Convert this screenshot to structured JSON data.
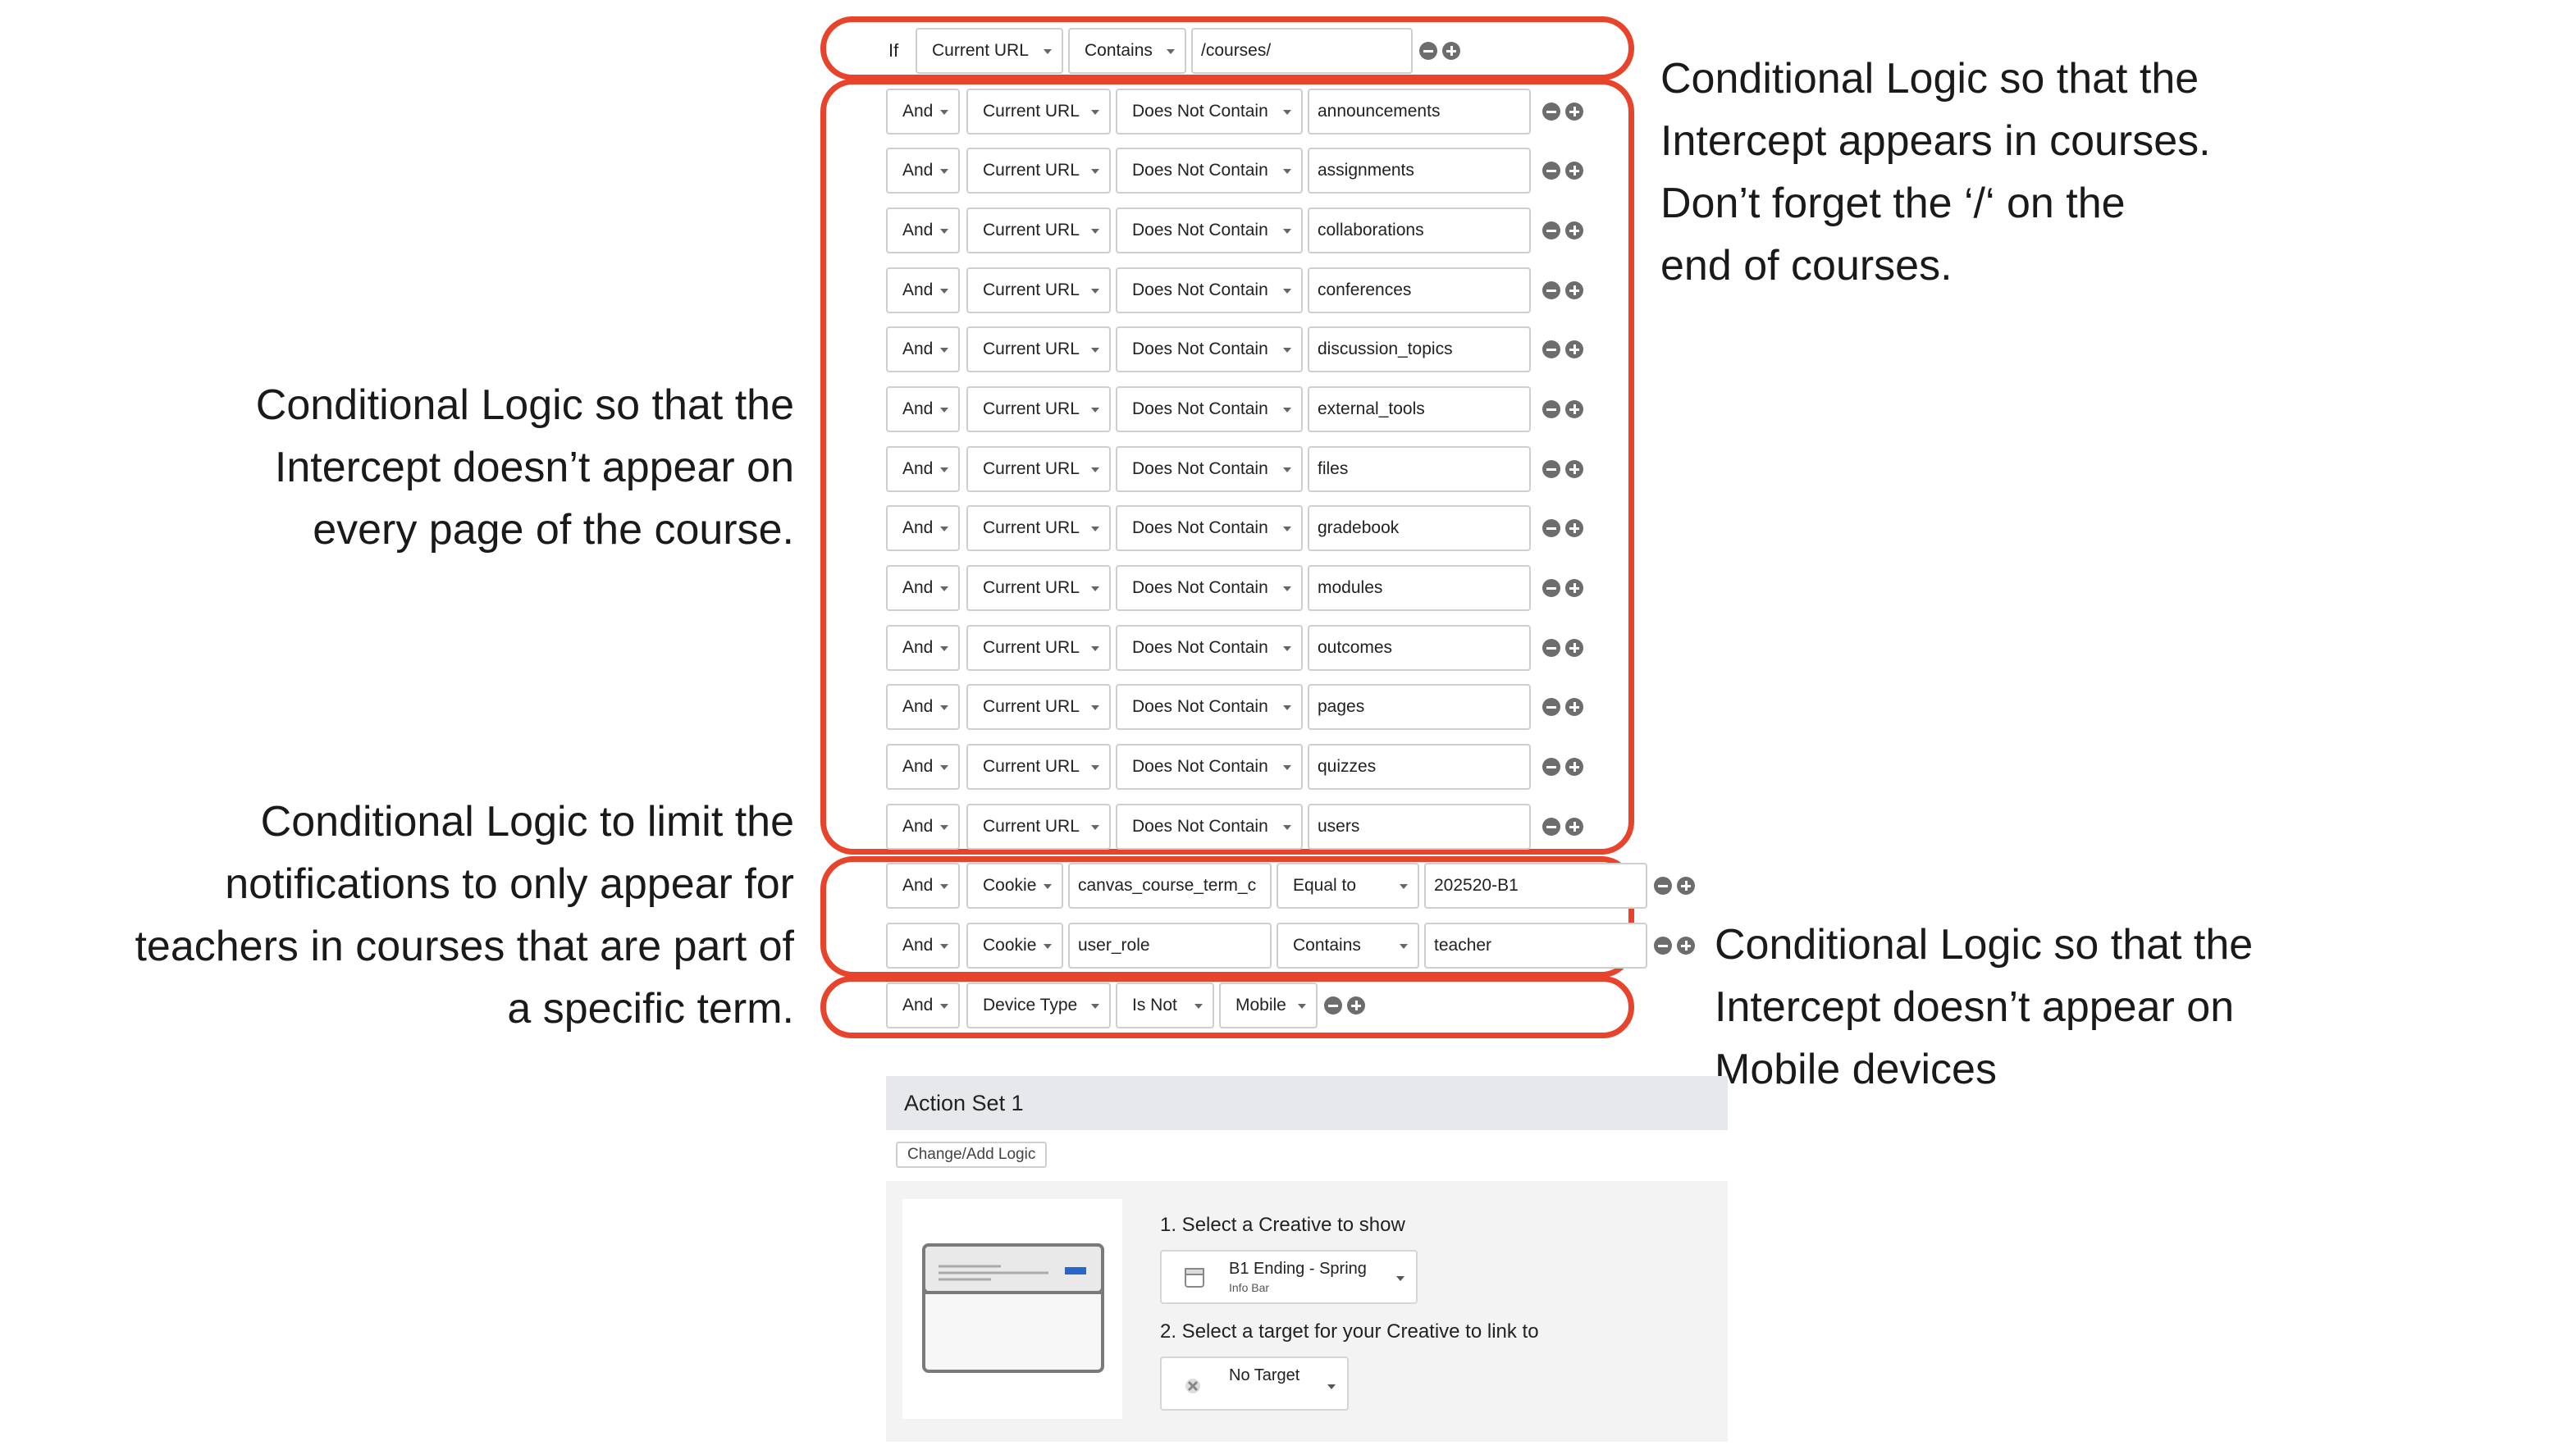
{
  "if_label": "If",
  "conditions": [
    {
      "conj": "If",
      "field": "Current URL",
      "op": "Contains",
      "value": "/courses/"
    },
    {
      "conj": "And",
      "field": "Current URL",
      "op": "Does Not Contain",
      "value": "announcements"
    },
    {
      "conj": "And",
      "field": "Current URL",
      "op": "Does Not Contain",
      "value": "assignments"
    },
    {
      "conj": "And",
      "field": "Current URL",
      "op": "Does Not Contain",
      "value": "collaborations"
    },
    {
      "conj": "And",
      "field": "Current URL",
      "op": "Does Not Contain",
      "value": "conferences"
    },
    {
      "conj": "And",
      "field": "Current URL",
      "op": "Does Not Contain",
      "value": "discussion_topics"
    },
    {
      "conj": "And",
      "field": "Current URL",
      "op": "Does Not Contain",
      "value": "external_tools"
    },
    {
      "conj": "And",
      "field": "Current URL",
      "op": "Does Not Contain",
      "value": "files"
    },
    {
      "conj": "And",
      "field": "Current URL",
      "op": "Does Not Contain",
      "value": "gradebook"
    },
    {
      "conj": "And",
      "field": "Current URL",
      "op": "Does Not Contain",
      "value": "modules"
    },
    {
      "conj": "And",
      "field": "Current URL",
      "op": "Does Not Contain",
      "value": "outcomes"
    },
    {
      "conj": "And",
      "field": "Current URL",
      "op": "Does Not Contain",
      "value": "pages"
    },
    {
      "conj": "And",
      "field": "Current URL",
      "op": "Does Not Contain",
      "value": "quizzes"
    },
    {
      "conj": "And",
      "field": "Current URL",
      "op": "Does Not Contain",
      "value": "users"
    },
    {
      "conj": "And",
      "field": "Cookie",
      "cookie_name": "canvas_course_term_c",
      "op": "Equal to",
      "value": "202520-B1"
    },
    {
      "conj": "And",
      "field": "Cookie",
      "cookie_name": "user_role",
      "op": "Contains",
      "value": "teacher"
    },
    {
      "conj": "And",
      "field": "Device Type",
      "op": "Is Not",
      "value": "Mobile"
    }
  ],
  "annotations": {
    "courses": [
      "Conditional Logic so that the",
      "Intercept appears in courses.",
      "Don’t forget the ‘/‘ on the",
      "end of courses."
    ],
    "every_page": [
      "Conditional Logic so that the",
      "Intercept doesn’t appear on",
      "every page of the course."
    ],
    "teachers": [
      "Conditional Logic to limit the",
      "notifications to only appear for",
      "teachers in courses that are part of",
      "a specific term."
    ],
    "mobile": [
      "Conditional Logic so that the",
      "Intercept doesn’t appear on",
      "Mobile devices"
    ]
  },
  "action_set": {
    "title": "Action Set 1",
    "change_logic": "Change/Add Logic",
    "step1": "1. Select a Creative to show",
    "creative_name": "B1 Ending - Spring",
    "creative_type": "Info Bar",
    "step2": "2. Select a target for your Creative to link to",
    "target": "No Target"
  },
  "colors": {
    "highlight": "#e8432b",
    "accent": "#2a66c9"
  }
}
